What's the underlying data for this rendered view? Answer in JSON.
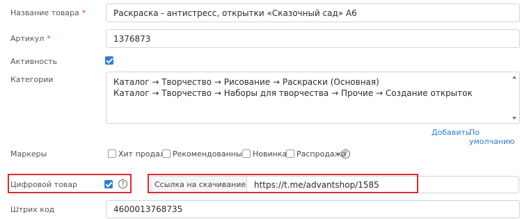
{
  "fields": {
    "name": {
      "label": "Название товара",
      "required": "*",
      "value": "Раскраска - антистресс, открытки «Сказочный сад» А6"
    },
    "sku": {
      "label": "Артикул",
      "required": "*",
      "value": "1376873"
    },
    "active": {
      "label": "Активность",
      "checked": true
    },
    "categories": {
      "label": "Категории",
      "lines": [
        "Каталог → Творчество → Рисование → Раскраски (Основная)",
        "Каталог → Творчество → Наборы для творчества → Прочие → Создание открыток"
      ],
      "add_link": "Добавить",
      "default_link": "По умолчанию"
    },
    "markers": {
      "label": "Маркеры",
      "items": [
        "Хит продаж",
        "Рекомендованный",
        "Новинка",
        "Распродажа"
      ],
      "help": "?"
    },
    "digital": {
      "label": "Цифровой товар",
      "checked": true,
      "help": "?"
    },
    "download": {
      "label": "Ссылка на скачивание",
      "value": "https://t.me/advantshop/1585"
    },
    "barcode": {
      "label": "Штрих код",
      "value": "4600013768735"
    }
  },
  "colors": {
    "accent": "#2d7ed8",
    "required": "#e0393e",
    "highlight": "#e0282e"
  }
}
